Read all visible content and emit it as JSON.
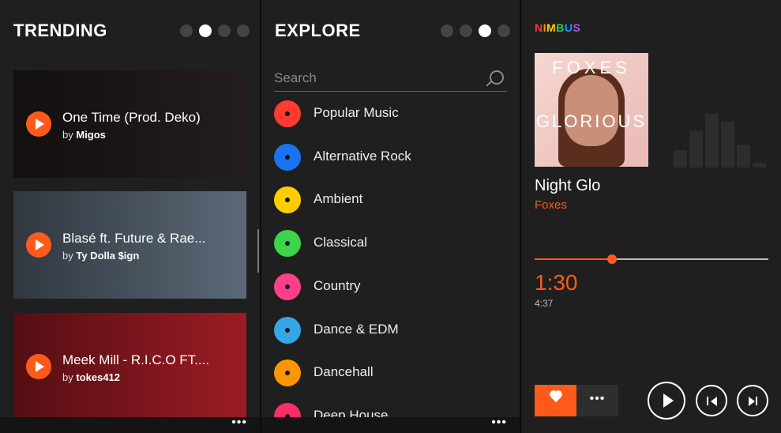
{
  "trending": {
    "title": "TRENDING",
    "pivot_active": 1,
    "cards": [
      {
        "title": "One Time (Prod. Deko)",
        "by": "by",
        "artist": "Migos",
        "bg": "#2a2222"
      },
      {
        "title": "Blasé ft. Future & Rae...",
        "by": "by",
        "artist": "Ty Dolla $ign",
        "bg": "#6b7b8c"
      },
      {
        "title": "Meek Mill - R.I.C.O FT....",
        "by": "by",
        "artist": "tokes412",
        "bg": "#b8202a"
      }
    ],
    "more": "•••"
  },
  "explore": {
    "title": "EXPLORE",
    "pivot_active": 2,
    "search_placeholder": "Search",
    "genres": [
      {
        "label": "Popular Music",
        "color": "#ff3a30"
      },
      {
        "label": "Alternative Rock",
        "color": "#1a73f0"
      },
      {
        "label": "Ambient",
        "color": "#ffcc00"
      },
      {
        "label": "Classical",
        "color": "#3bd44a"
      },
      {
        "label": "Country",
        "color": "#ff3f8a"
      },
      {
        "label": "Dance & EDM",
        "color": "#35a6e8"
      },
      {
        "label": "Dancehall",
        "color": "#ff9500"
      },
      {
        "label": "Deep House",
        "color": "#ff2d6a"
      }
    ],
    "more": "•••"
  },
  "player": {
    "logo": "NIMBUS",
    "logo_colors": [
      "#ff3b30",
      "#ff9500",
      "#ffcc00",
      "#34c759",
      "#1e90ff",
      "#af52de"
    ],
    "album_line1": "FOXES",
    "album_line2": "GLORIOUS",
    "song": "Night Glo",
    "artist": "Foxes",
    "elapsed": "1:30",
    "total": "4:37",
    "progress": 0.33,
    "equalizer_levels": [
      0.3,
      0.65,
      0.95,
      0.8,
      0.4,
      0.08
    ],
    "more": "•••",
    "accent": "#ff5a1a"
  }
}
